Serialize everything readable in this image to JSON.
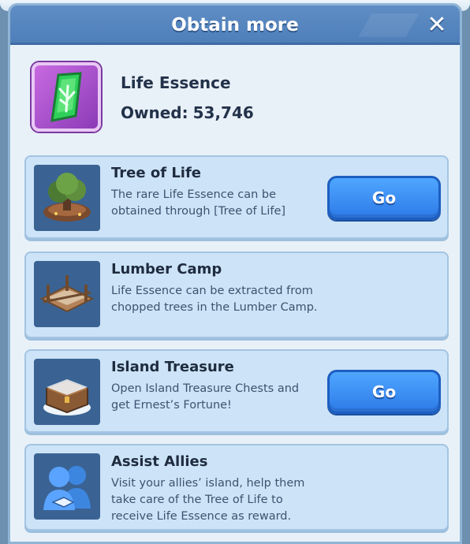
{
  "dialog": {
    "title": "Obtain more",
    "close_label": "✕"
  },
  "item": {
    "name": "Life Essence",
    "owned_label": "Owned:",
    "owned_value": "53,746",
    "icon": "life-essence-icon"
  },
  "sources": [
    {
      "title": "Tree of Life",
      "description": "The rare Life Essence can be obtained through [Tree of Life]",
      "icon": "tree-of-life-icon",
      "button_label": "Go"
    },
    {
      "title": "Lumber Camp",
      "description": "Life Essence can be extracted from chopped trees in the Lumber Camp.",
      "icon": "lumber-camp-icon",
      "button_label": null
    },
    {
      "title": "Island Treasure",
      "description": "Open Island Treasure Chests and get Ernest’s Fortune!",
      "icon": "treasure-chest-icon",
      "button_label": "Go"
    },
    {
      "title": "Assist Allies",
      "description": "Visit your allies’ island, help them take care of the Tree of Life to receive Life Essence as reward.",
      "icon": "allies-handshake-icon",
      "button_label": null
    }
  ],
  "colors": {
    "header": "#5f8dc4",
    "card": "#cde3f7",
    "button": "#2d7be8",
    "item_frame": "#a64fd0"
  }
}
